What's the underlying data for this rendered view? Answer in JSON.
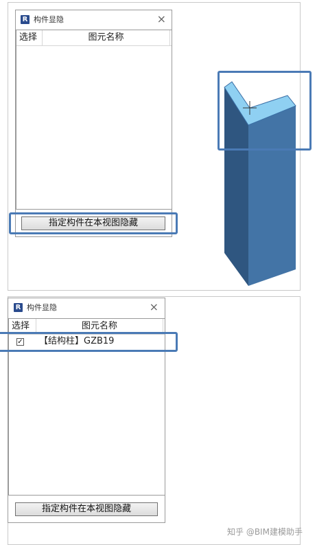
{
  "dialog_top": {
    "title": "构件显隐",
    "close": "×",
    "columns": {
      "select": "选择",
      "name": "图元名称"
    },
    "hide_button": "指定构件在本视图隐藏"
  },
  "dialog_bottom": {
    "title": "构件显隐",
    "close": "×",
    "columns": {
      "select": "选择",
      "name": "图元名称"
    },
    "rows": [
      {
        "checked": true,
        "check_mark": "✓",
        "label": "【结构柱】GZB19"
      }
    ],
    "hide_button": "指定构件在本视图隐藏"
  },
  "logo_letter": "R",
  "watermark": "知乎 @BIM建模助手",
  "colors": {
    "highlight": "#4a7ab5",
    "column_top": "#8fd0f2",
    "column_left": "#2f5680",
    "column_right": "#4374a6"
  }
}
